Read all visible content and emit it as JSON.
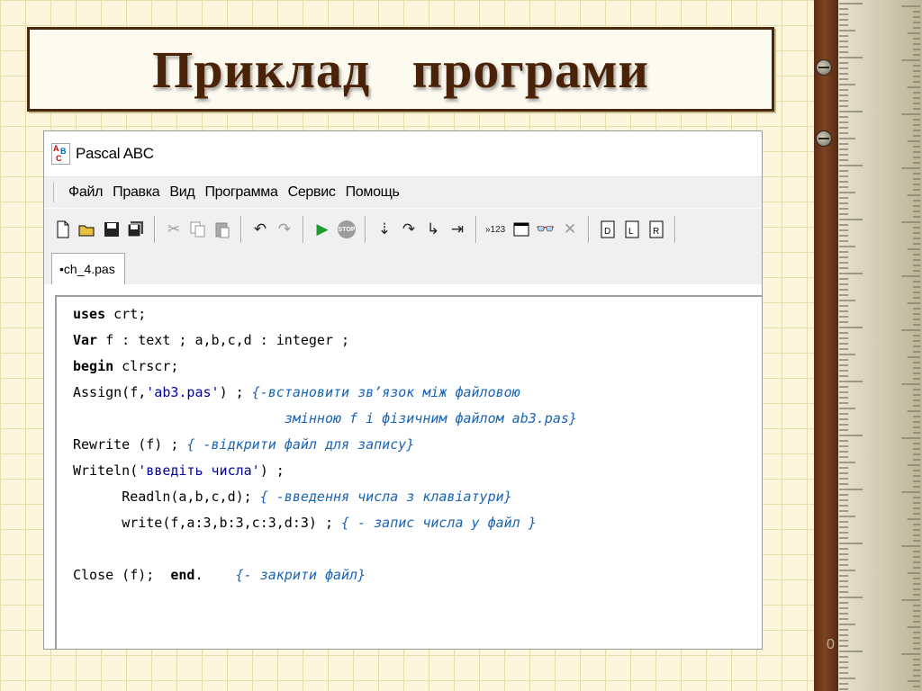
{
  "slide": {
    "title": "Приклад   програми",
    "number": "0"
  },
  "window": {
    "title": "Pascal ABC",
    "icon_letters": [
      "A",
      "B",
      "C"
    ]
  },
  "menu": [
    "Файл",
    "Правка",
    "Вид",
    "Программа",
    "Сервис",
    "Помощь"
  ],
  "toolbar": {
    "counter_label": "»123",
    "stop_label": "STOP",
    "doc_letters": [
      "D",
      "L",
      "R"
    ]
  },
  "tab": {
    "label": "•ch_4.pas"
  },
  "code": {
    "l1_kw": "uses",
    "l1_rest": " crt;",
    "l2_kw": "Var",
    "l2_rest": " f : text ; a,b,c,d : integer ;",
    "l3_kw": "begin",
    "l3_rest": " clrscr;",
    "l4_a": "Assign(f,",
    "l4_str": "'ab3.pas'",
    "l4_b": ") ; ",
    "l4_cm": "{-встановити зв’язок між файловою",
    "l5_indent": "                          ",
    "l5_cm": "змінною f і фізичним файлом ab3.pas}",
    "l6_a": "Rewrite (f) ; ",
    "l6_cm": "{ -відкрити файл для запису}",
    "l7_a": "Writeln(",
    "l7_str": "'введіть числа'",
    "l7_b": ") ;",
    "l8_indent": "      ",
    "l8_a": "Readln(a,b,c,d); ",
    "l8_cm": "{ -введення числа з клавіатури}",
    "l9_indent": "      ",
    "l9_a": "write(f,a:3,b:3,c:3,d:3) ; ",
    "l9_cm": "{ - запис числа у файл }",
    "l11_a": "Close (f);  ",
    "l11_kw": "end",
    "l11_b": ".    ",
    "l11_cm": "{- закрити файл}"
  },
  "colors": {
    "title_text": "#4a2208",
    "title_border": "#4a2810",
    "comment": "#1a64b4",
    "string": "#0000a0",
    "run_green": "#1f9a2c"
  }
}
